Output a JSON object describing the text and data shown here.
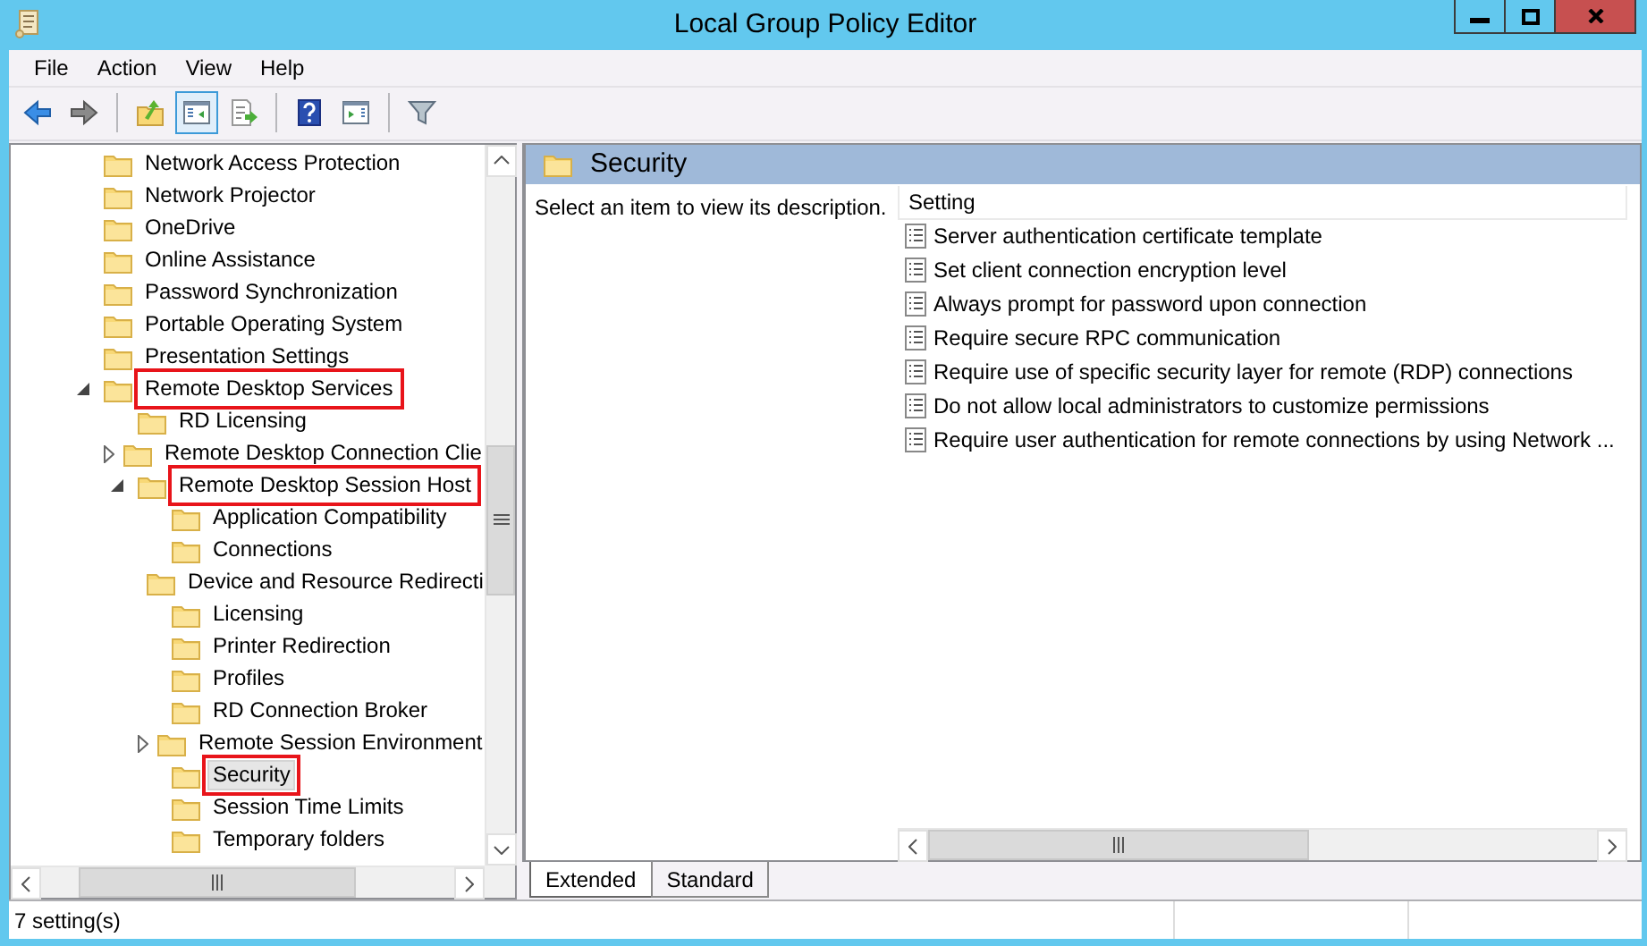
{
  "window": {
    "title": "Local Group Policy Editor"
  },
  "menu": [
    "File",
    "Action",
    "View",
    "Help"
  ],
  "toolbar": [
    [
      {
        "kind": "back",
        "pressed": false
      },
      {
        "kind": "forward",
        "pressed": false
      }
    ],
    [
      {
        "kind": "up",
        "pressed": false
      },
      {
        "kind": "tree",
        "pressed": true
      },
      {
        "kind": "export",
        "pressed": false
      }
    ],
    [
      {
        "kind": "help",
        "pressed": false
      },
      {
        "kind": "action-pane",
        "pressed": false
      }
    ],
    [
      {
        "kind": "filter",
        "pressed": false
      }
    ]
  ],
  "tree": {
    "items": [
      {
        "label": "Network Access Protection",
        "selected": false,
        "highlighted": false
      },
      {
        "label": "Network Projector",
        "selected": false,
        "highlighted": false
      },
      {
        "label": "OneDrive",
        "selected": false,
        "highlighted": false
      },
      {
        "label": "Online Assistance",
        "selected": false,
        "highlighted": false
      },
      {
        "label": "Password Synchronization",
        "selected": false,
        "highlighted": false
      },
      {
        "label": "Portable Operating System",
        "selected": false,
        "highlighted": false
      },
      {
        "label": "Presentation Settings",
        "selected": false,
        "highlighted": false
      },
      {
        "label": "Remote Desktop Services",
        "expanded": true,
        "selected": false,
        "highlighted": true,
        "children": [
          {
            "label": "RD Licensing",
            "selected": false,
            "highlighted": false
          },
          {
            "label": "Remote Desktop Connection Clie",
            "expanded": false,
            "selected": false,
            "highlighted": false
          },
          {
            "label": "Remote Desktop Session Host",
            "expanded": true,
            "selected": false,
            "highlighted": true,
            "children": [
              {
                "label": "Application Compatibility",
                "selected": false,
                "highlighted": false
              },
              {
                "label": "Connections",
                "selected": false,
                "highlighted": false
              },
              {
                "label": "Device and Resource Redirecti",
                "selected": false,
                "highlighted": false
              },
              {
                "label": "Licensing",
                "selected": false,
                "highlighted": false
              },
              {
                "label": "Printer Redirection",
                "selected": false,
                "highlighted": false
              },
              {
                "label": "Profiles",
                "selected": false,
                "highlighted": false
              },
              {
                "label": "RD Connection Broker",
                "selected": false,
                "highlighted": false
              },
              {
                "label": "Remote Session Environment",
                "expanded": false,
                "selected": false,
                "highlighted": false
              },
              {
                "label": "Security",
                "selected": true,
                "highlighted": true
              },
              {
                "label": "Session Time Limits",
                "selected": false,
                "highlighted": false
              },
              {
                "label": "Temporary folders",
                "selected": false,
                "highlighted": false
              }
            ]
          }
        ]
      }
    ]
  },
  "details": {
    "title": "Security",
    "description": "Select an item to view its description.",
    "column": "Setting",
    "settings": [
      "Server authentication certificate template",
      "Set client connection encryption level",
      "Always prompt for password upon connection",
      "Require secure RPC communication",
      "Require use of specific security layer for remote (RDP) connections",
      "Do not allow local administrators to customize permissions",
      "Require user authentication for remote connections by using Network ..."
    ]
  },
  "view_tabs": [
    {
      "label": "Extended",
      "selected": true
    },
    {
      "label": "Standard",
      "selected": false
    }
  ],
  "status_bar": {
    "text": "7 setting(s)"
  }
}
